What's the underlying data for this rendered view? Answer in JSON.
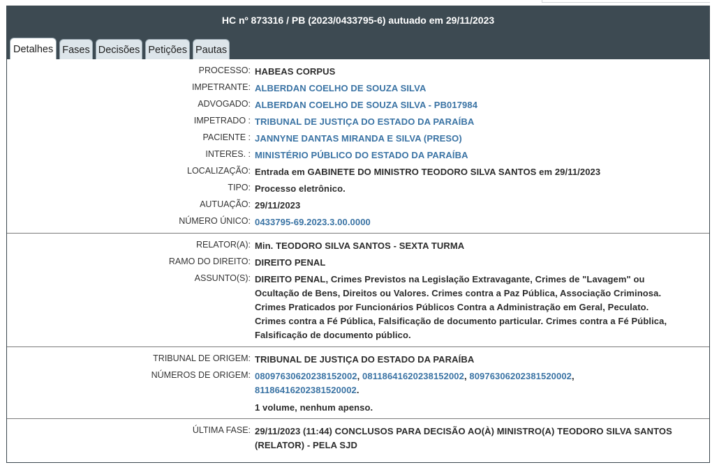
{
  "header": {
    "title": "HC nº 873316 / PB (2023/0433795-6) autuado em 29/11/2023"
  },
  "tabs": [
    {
      "label": "Detalhes",
      "active": true
    },
    {
      "label": "Fases",
      "active": false
    },
    {
      "label": "Decisões",
      "active": false
    },
    {
      "label": "Petições",
      "active": false
    },
    {
      "label": "Pautas",
      "active": false
    }
  ],
  "details": {
    "processo": {
      "label": "PROCESSO:",
      "value": "HABEAS CORPUS"
    },
    "impetrante": {
      "label": "IMPETRANTE:",
      "value": "ALBERDAN COELHO DE SOUZA SILVA"
    },
    "advogado": {
      "label": "ADVOGADO:",
      "value": "ALBERDAN COELHO DE SOUZA SILVA - PB017984"
    },
    "impetrado": {
      "label": "IMPETRADO :",
      "value": "TRIBUNAL DE JUSTIÇA DO ESTADO DA PARAÍBA"
    },
    "paciente": {
      "label": "PACIENTE :",
      "value": "JANNYNE DANTAS MIRANDA E SILVA (PRESO)"
    },
    "interes": {
      "label": "INTERES. :",
      "value": "MINISTÉRIO PÚBLICO DO ESTADO DA PARAÍBA"
    },
    "localizacao": {
      "label": "LOCALIZAÇÃO:",
      "value": "Entrada em GABINETE DO MINISTRO TEODORO SILVA SANTOS em 29/11/2023"
    },
    "tipo": {
      "label": "TIPO:",
      "value": "Processo eletrônico."
    },
    "autuacao": {
      "label": "AUTUAÇÃO:",
      "value": "29/11/2023"
    },
    "numero_unico": {
      "label": "NÚMERO ÚNICO:",
      "value": "0433795-69.2023.3.00.0000"
    }
  },
  "relator_section": {
    "relator": {
      "label": "RELATOR(A):",
      "value": "Min. TEODORO SILVA SANTOS - SEXTA TURMA"
    },
    "ramo": {
      "label": "RAMO DO DIREITO:",
      "value": "DIREITO PENAL"
    },
    "assuntos": {
      "label": "ASSUNTO(S):",
      "value": "DIREITO PENAL, Crimes Previstos na Legislação Extravagante, Crimes de \"Lavagem\" ou Ocultação de Bens, Direitos ou Valores. Crimes contra a Paz Pública, Associação Criminosa. Crimes Praticados por Funcionários Públicos Contra a Administração em Geral, Peculato. Crimes contra a Fé Pública, Falsificação de documento particular. Crimes contra a Fé Pública, Falsificação de documento público."
    }
  },
  "origem": {
    "tribunal": {
      "label": "TRIBUNAL DE ORIGEM:",
      "value": "TRIBUNAL DE JUSTIÇA DO ESTADO DA PARAÍBA"
    },
    "numeros_label": "NÚMEROS DE ORIGEM:",
    "numeros": [
      "08097630620238152002",
      "08118641620238152002",
      "80976306202381520002",
      "81186416202381520002"
    ],
    "separator": ", ",
    "end_punct": ".",
    "volume": "1 volume, nenhum apenso."
  },
  "ultima_fase": {
    "label": "ÚLTIMA FASE:",
    "value": "29/11/2023 (11:44) CONCLUSOS PARA DECISÃO AO(À) MINISTRO(A) TEODORO SILVA SANTOS (RELATOR) - PELA SJD"
  }
}
